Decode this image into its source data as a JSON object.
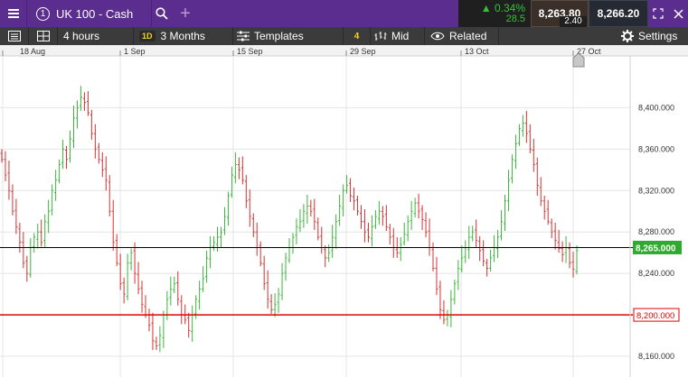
{
  "header": {
    "instrument_number": "1",
    "instrument_name": "UK 100 - Cash",
    "change_pct": "0.34%",
    "change_points": "28.5",
    "sell_price": "8,263.80",
    "buy_price": "8,266.20",
    "spread": "2.40",
    "colors": {
      "purple": "#5b2d8e",
      "up": "#35c235"
    }
  },
  "toolbar": {
    "interval": "4 hours",
    "period_tag": "1D",
    "period": "3 Months",
    "templates": "Templates",
    "templates_count": "4",
    "price_type": "Mid",
    "related": "Related",
    "settings": "Settings"
  },
  "chart_data": {
    "type": "ohlc",
    "x_labels": [
      "18 Aug",
      "1 Sep",
      "15 Sep",
      "29 Sep",
      "13 Oct",
      "27 Oct"
    ],
    "y_ticks": [
      "8,400.000",
      "8,360.000",
      "8,320.000",
      "8,280.000",
      "8,240.000",
      "8,160.000"
    ],
    "y_range": [
      8140,
      8450
    ],
    "current_price_label": "8,265.000",
    "current_price": 8265,
    "horizontal_line_label": "8,200.000",
    "horizontal_line": 8200,
    "grid": true,
    "colors": {
      "up": "#3cb43c",
      "down": "#d23232",
      "hline": "#e00000"
    },
    "points": [
      8350,
      8335,
      8320,
      8300,
      8285,
      8270,
      8250,
      8240,
      8265,
      8275,
      8280,
      8270,
      8290,
      8300,
      8320,
      8330,
      8345,
      8360,
      8350,
      8370,
      8390,
      8400,
      8410,
      8405,
      8395,
      8375,
      8360,
      8350,
      8340,
      8330,
      8300,
      8270,
      8250,
      8230,
      8220,
      8250,
      8260,
      8240,
      8225,
      8210,
      8200,
      8190,
      8175,
      8170,
      8180,
      8200,
      8215,
      8225,
      8230,
      8215,
      8200,
      8195,
      8185,
      8200,
      8215,
      8225,
      8235,
      8255,
      8265,
      8270,
      8275,
      8280,
      8295,
      8315,
      8335,
      8345,
      8340,
      8330,
      8310,
      8295,
      8280,
      8265,
      8250,
      8230,
      8215,
      8205,
      8210,
      8220,
      8240,
      8255,
      8265,
      8275,
      8285,
      8290,
      8300,
      8305,
      8300,
      8290,
      8275,
      8265,
      8255,
      8260,
      8275,
      8290,
      8305,
      8320,
      8325,
      8315,
      8310,
      8300,
      8290,
      8280,
      8275,
      8285,
      8295,
      8300,
      8295,
      8285,
      8275,
      8265,
      8260,
      8268,
      8278,
      8290,
      8300,
      8308,
      8300,
      8292,
      8280,
      8265,
      8245,
      8225,
      8205,
      8195,
      8200,
      8215,
      8230,
      8245,
      8255,
      8265,
      8275,
      8280,
      8272,
      8262,
      8252,
      8245,
      8255,
      8265,
      8275,
      8290,
      8310,
      8330,
      8350,
      8365,
      8380,
      8385,
      8375,
      8360,
      8345,
      8325,
      8310,
      8300,
      8290,
      8280,
      8272,
      8264,
      8258,
      8265,
      8250,
      8244,
      8262
    ]
  }
}
